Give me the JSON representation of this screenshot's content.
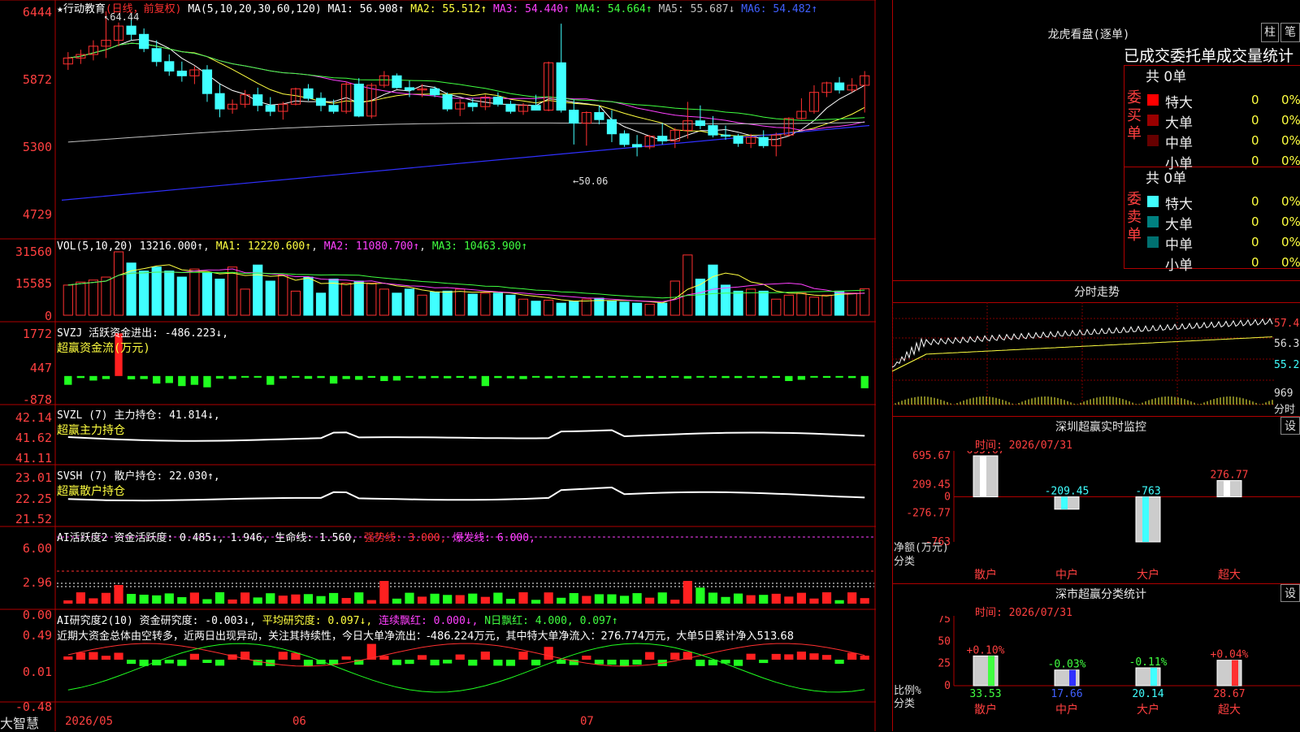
{
  "app": {
    "brand": "大智慧",
    "stock": "★行动教育",
    "stock_tag": "(日线，前复权)"
  },
  "kline": {
    "ma_label": "MA(5,10,20,30,60,120)",
    "ma": [
      {
        "name": "MA1:",
        "value": "56.908↑",
        "color": "#ffffff"
      },
      {
        "name": "MA2:",
        "value": "55.512↑",
        "color": "#ffff40"
      },
      {
        "name": "MA3:",
        "value": "54.440↑",
        "color": "#ff40ff"
      },
      {
        "name": "MA4:",
        "value": "54.664↑",
        "color": "#40ff40"
      },
      {
        "name": "MA5:",
        "value": "55.687↓",
        "color": "#c0c0c0"
      },
      {
        "name": "MA6:",
        "value": "54.482↑",
        "color": "#4060ff"
      }
    ],
    "y_ticks": [
      "6444",
      "5872",
      "5300",
      "4729"
    ],
    "hi_mark": "64.44",
    "lo_mark": "←50.06"
  },
  "vol": {
    "title": "VOL(5,10,20)",
    "value": "13216.000↑",
    "ma1": "MA1: 12220.600↑",
    "ma2": "MA2: 11080.700↑",
    "ma3": "MA3: 10463.900↑",
    "y_ticks": [
      "31560",
      "15585",
      "0"
    ]
  },
  "svzj": {
    "title": "SVZJ",
    "label": "活跃资金进出: -486.223↓,",
    "subtitle": "超赢资金流(万元)",
    "y_ticks": [
      "1772",
      "447",
      "-878"
    ]
  },
  "svzl": {
    "title": "SVZL (7)",
    "label": "主力持仓: 41.814↓,",
    "subtitle": "超赢主力持仓",
    "y_ticks": [
      "42.14",
      "41.62",
      "41.11"
    ]
  },
  "svsh": {
    "title": "SVSH (7)",
    "label": "散户持仓: 22.030↑,",
    "subtitle": "超赢散户持仓",
    "y_ticks": [
      "23.01",
      "22.25",
      "21.52"
    ]
  },
  "ai_active": {
    "title": "AI活跃度2",
    "label": "资金活跃度: 0.485↓, 1.946,",
    "life": "生命线: 1.560,",
    "strong": "强势线: 3.000,",
    "burst": "爆发线: 6.000,",
    "y_ticks": [
      "6.00",
      "2.96",
      "0.00"
    ]
  },
  "ai_research": {
    "title": "AI研究度2(10)",
    "label": "资金研究度: -0.003↓,",
    "avg": "平均研究度: 0.097↓,",
    "cont": "连续飘红: 0.000↓,",
    "nday": "N日飘红: 4.000, 0.097↑",
    "comment": "近期大资金总体由空转多，近两日出现异动，关注其持续性，今日大单净流出：-486.224万元，其中特大单净流入：276.774万元，大单5日累计净入513.68",
    "y_ticks": [
      "0.49",
      "0.01",
      "-0.48"
    ]
  },
  "x_axis": [
    "2026/05",
    "06",
    "07"
  ],
  "right": {
    "dragon_title": "龙虎看盘(逐单)",
    "btn_bar": "柱",
    "btn_pen": "笔",
    "order_title": "已成交委托单成交量统计",
    "buy_label": "委买单",
    "sell_label": "委卖单",
    "buy_total": "共 0单",
    "sell_total": "共 0单",
    "sizes": [
      "特大",
      "大单",
      "中单",
      "小单"
    ],
    "zero": "0",
    "pct": "0%",
    "intraday_title": "分时走势",
    "intraday_ticks": [
      "57.41",
      "56.31",
      "55.21",
      "969",
      "分时"
    ],
    "monitor_title": "深圳超赢实时监控",
    "monitor_time": "时间: 2026/07/31",
    "monitor_yticks": [
      "695.67",
      "209.45",
      "0",
      "-276.77",
      "-763"
    ],
    "monitor_ylabel": "净额(万元)",
    "monitor_xlabel": "分类",
    "monitor_cats": [
      "散户",
      "中户",
      "大户",
      "超大"
    ],
    "monitor_vals": [
      "695.67",
      "-209.45",
      "-763",
      "276.77"
    ],
    "stat_title": "深市超赢分类统计",
    "stat_time": "时间: 2026/07/31",
    "stat_yticks": [
      "75",
      "50",
      "25",
      "0"
    ],
    "stat_ylabel": "比例%",
    "stat_xlabel": "分类",
    "stat_top": [
      "+0.10%",
      "-0.03%",
      "-0.11%",
      "+0.04%"
    ],
    "stat_bottom": [
      "33.53",
      "17.66",
      "20.14",
      "28.67"
    ],
    "btn_set": "设"
  },
  "chart_data": [
    {
      "type": "candlestick",
      "title": "行动教育 日线 前复权",
      "ylim": [
        47.29,
        64.44
      ],
      "ohlc": [
        [
          60.0,
          61.0,
          59.5,
          60.5
        ],
        [
          60.5,
          61.2,
          60.0,
          60.8
        ],
        [
          60.8,
          62.0,
          60.3,
          61.5
        ],
        [
          61.5,
          64.44,
          60.5,
          62.0
        ],
        [
          62.0,
          63.5,
          61.5,
          63.2
        ],
        [
          63.2,
          63.8,
          62.0,
          62.5
        ],
        [
          62.5,
          63.0,
          61.0,
          61.3
        ],
        [
          61.3,
          62.0,
          59.8,
          60.2
        ],
        [
          60.2,
          60.8,
          59.0,
          59.4
        ],
        [
          59.4,
          60.2,
          58.5,
          59.0
        ],
        [
          59.0,
          59.8,
          58.3,
          59.5
        ],
        [
          59.5,
          59.9,
          56.8,
          57.5
        ],
        [
          57.5,
          58.3,
          55.5,
          56.2
        ],
        [
          56.2,
          57.0,
          55.8,
          56.6
        ],
        [
          56.6,
          57.8,
          56.3,
          57.4
        ],
        [
          57.4,
          58.0,
          56.0,
          56.5
        ],
        [
          56.5,
          57.2,
          55.6,
          56.0
        ],
        [
          56.0,
          56.8,
          55.3,
          56.6
        ],
        [
          56.6,
          58.0,
          56.5,
          57.9
        ],
        [
          57.9,
          58.3,
          56.9,
          57.1
        ],
        [
          57.1,
          57.6,
          56.0,
          56.5
        ],
        [
          56.5,
          57.0,
          55.8,
          56.0
        ],
        [
          56.0,
          58.5,
          55.8,
          58.3
        ],
        [
          58.3,
          58.8,
          55.5,
          55.6
        ],
        [
          55.6,
          58.4,
          55.4,
          58.2
        ],
        [
          58.2,
          59.4,
          58.0,
          59.0
        ],
        [
          59.0,
          59.2,
          57.9,
          58.0
        ],
        [
          58.0,
          58.6,
          57.2,
          57.8
        ],
        [
          57.8,
          58.3,
          57.2,
          57.9
        ],
        [
          57.9,
          58.1,
          57.2,
          57.4
        ],
        [
          57.4,
          57.6,
          56.0,
          56.2
        ],
        [
          56.2,
          57.0,
          55.6,
          56.7
        ],
        [
          56.7,
          57.1,
          56.0,
          56.4
        ],
        [
          56.4,
          57.4,
          56.1,
          57.2
        ],
        [
          57.2,
          57.6,
          56.4,
          56.6
        ],
        [
          56.6,
          56.9,
          55.8,
          56.0
        ],
        [
          56.0,
          56.7,
          55.7,
          56.5
        ],
        [
          56.5,
          57.4,
          56.1,
          56.1
        ],
        [
          56.1,
          60.2,
          56.0,
          60.1
        ],
        [
          60.1,
          63.4,
          55.9,
          56.1
        ],
        [
          56.1,
          57.0,
          53.2,
          55.0
        ],
        [
          55.0,
          56.0,
          53.1,
          55.9
        ],
        [
          55.9,
          56.5,
          54.9,
          55.3
        ],
        [
          55.3,
          56.1,
          53.4,
          54.1
        ],
        [
          54.1,
          54.4,
          53.0,
          53.2
        ],
        [
          53.2,
          54.0,
          52.2,
          53.0
        ],
        [
          53.0,
          54.0,
          52.8,
          53.9
        ],
        [
          53.9,
          55.0,
          53.2,
          53.5
        ],
        [
          53.5,
          54.6,
          52.9,
          54.4
        ],
        [
          54.4,
          56.8,
          53.7,
          55.2
        ],
        [
          55.2,
          56.5,
          54.5,
          54.8
        ],
        [
          54.8,
          55.6,
          53.8,
          54.0
        ],
        [
          54.0,
          54.8,
          53.6,
          53.9
        ],
        [
          53.9,
          54.1,
          53.0,
          53.3
        ],
        [
          53.3,
          54.1,
          52.9,
          53.8
        ],
        [
          53.8,
          54.4,
          52.9,
          53.1
        ],
        [
          53.1,
          54.2,
          52.2,
          54.0
        ],
        [
          54.0,
          55.5,
          53.9,
          55.4
        ],
        [
          55.4,
          57.1,
          55.3,
          56.0
        ],
        [
          56.0,
          58.2,
          55.8,
          57.6
        ],
        [
          57.6,
          58.5,
          57.2,
          58.4
        ],
        [
          58.4,
          58.9,
          57.5,
          57.8
        ],
        [
          57.8,
          58.8,
          57.6,
          58.2
        ],
        [
          58.2,
          59.4,
          55.9,
          59.0
        ]
      ]
    },
    {
      "type": "bar",
      "title": "VOL(5,10,20)",
      "ylim": [
        0,
        31560
      ],
      "values": [
        15000,
        16500,
        17500,
        19000,
        31560,
        26000,
        22000,
        24000,
        22000,
        19000,
        23000,
        21000,
        18000,
        24000,
        13000,
        25000,
        17000,
        20000,
        12000,
        19000,
        11000,
        18000,
        16000,
        17000,
        16000,
        13000,
        11000,
        13000,
        10000,
        11500,
        12000,
        13000,
        10500,
        11000,
        11000,
        10000,
        8000,
        7000,
        7500,
        6000,
        7000,
        8000,
        8500,
        7000,
        6500,
        6000,
        5500,
        6000,
        17000,
        30000,
        18000,
        25000,
        15000,
        12000,
        13000,
        12000,
        8000,
        10000,
        11000,
        9000,
        10000,
        12000,
        11000,
        13216
      ]
    },
    {
      "type": "bar",
      "title": "SVZJ 活跃资金进出",
      "ylim": [
        -878,
        1772
      ],
      "values": [
        -350,
        -80,
        -180,
        -120,
        1700,
        -130,
        -120,
        -300,
        -280,
        -400,
        -350,
        -450,
        -100,
        -120,
        -60,
        -50,
        -350,
        -100,
        -50,
        -110,
        -80,
        -300,
        -120,
        -150,
        -70,
        -200,
        -180,
        -60,
        -100,
        -80,
        -90,
        -70,
        -100,
        -400,
        -80,
        -90,
        -120,
        -40,
        -90,
        -40,
        -40,
        -80,
        -60,
        -40,
        -50,
        -60,
        -80,
        -70,
        -60,
        -100,
        -40,
        -40,
        -80,
        -80,
        -50,
        -80,
        -70,
        -200,
        -150,
        -60,
        -70,
        -60,
        -80,
        -486.223
      ]
    },
    {
      "type": "line",
      "title": "SVZL 主力持仓",
      "ylim": [
        41.11,
        42.14
      ]
    },
    {
      "type": "line",
      "title": "SVSH 散户持仓",
      "ylim": [
        21.52,
        23.01
      ]
    },
    {
      "type": "bar",
      "title": "AI活跃度2",
      "ylim": [
        0,
        6
      ]
    },
    {
      "type": "bar",
      "title": "AI研究度2(10)",
      "ylim": [
        -0.48,
        0.49
      ]
    },
    {
      "type": "bar",
      "title": "深圳超赢实时监控",
      "categories": [
        "散户",
        "中户",
        "大户",
        "超大"
      ],
      "values": [
        695.67,
        -209.45,
        -763,
        276.77
      ],
      "ylim": [
        -763,
        695.67
      ]
    },
    {
      "type": "bar",
      "title": "深市超赢分类统计",
      "categories": [
        "散户",
        "中户",
        "大户",
        "超大"
      ],
      "values": [
        33.53,
        17.66,
        20.14,
        28.67
      ],
      "ylim": [
        0,
        75
      ]
    }
  ]
}
